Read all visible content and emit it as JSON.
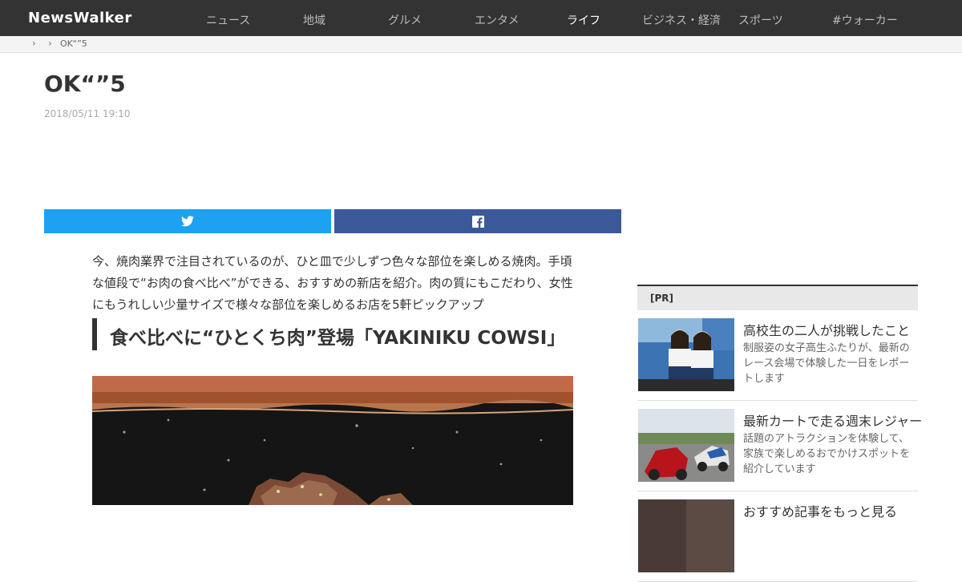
{
  "header": {
    "logo": "NewsWalker",
    "nav": [
      {
        "label": "ニュース"
      },
      {
        "label": "地域"
      },
      {
        "label": "グルメ"
      },
      {
        "label": "エンタメ"
      },
      {
        "label": "ライフ"
      },
      {
        "label": "ビジネス・経済"
      },
      {
        "label": "スポーツ"
      },
      {
        "label": "#ウォーカー"
      }
    ]
  },
  "breadcrumb": {
    "sep": "›",
    "current": "OK“”5"
  },
  "article": {
    "title": "OK“”5",
    "date": "2018/05/11 19:10",
    "lead": "今、焼肉業界で注目されているのが、ひと皿で少しずつ色々な部位を楽しめる焼肉。手頃な値段で“お肉の食べ比べ”ができる、おすすめの新店を紹介。肉の質にもこだわり、女性にもうれしい少量サイズで様々な部位を楽しめるお店を5軒ピックアップ",
    "h2": "食べ比べに“ひとくち肉”登場「YAKINIKU COWSI」"
  },
  "sidebar": {
    "pr_label": "[PR]",
    "cards": [
      {
        "title": "高校生の二人が挑戦したこと",
        "desc": "制服姿の女子高生ふたりが、最新のレース会場で体験した一日をレポートします"
      },
      {
        "title": "最新カートで走る週末レジャー",
        "desc": "話題のアトラクションを体験して、家族で楽しめるおでかけスポットを紹介しています"
      },
      {
        "title": "おすすめ記事をもっと見る",
        "desc": ""
      }
    ]
  },
  "colors": {
    "nav_bg": "#333333",
    "twitter": "#1da1f2",
    "facebook": "#3b5998"
  },
  "icons": {
    "twitter": "twitter-icon",
    "facebook": "facebook-icon",
    "breadcrumb": "chevron-right-icon"
  }
}
